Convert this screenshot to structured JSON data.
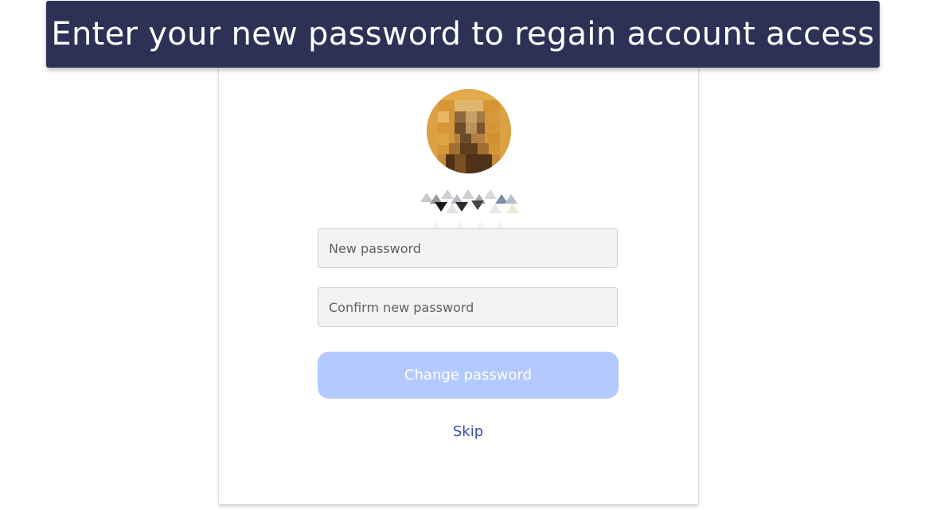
{
  "banner": {
    "title": "Enter your new password to regain account access",
    "background": "#2e3156"
  },
  "profile": {
    "avatar_icon": "pixelated-avatar",
    "username_icon": "pixelated-username"
  },
  "form": {
    "new_password": {
      "placeholder": "New password",
      "value": ""
    },
    "confirm_password": {
      "placeholder": "Confirm new password",
      "value": ""
    },
    "submit_label": "Change password",
    "submit_color": "#b4c9ff",
    "skip_label": "Skip",
    "skip_color": "#2f4fae"
  }
}
